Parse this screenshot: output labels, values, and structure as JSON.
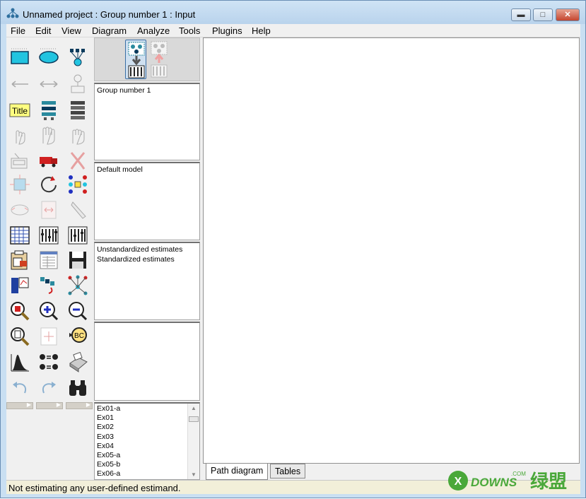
{
  "window": {
    "title": "Unnamed project : Group number 1 : Input",
    "controls": [
      "minimize",
      "maximize",
      "close"
    ]
  },
  "menu": {
    "items": [
      "File",
      "Edit",
      "View",
      "Diagram",
      "Analyze",
      "Tools",
      "Plugins",
      "Help"
    ]
  },
  "toolbox": {
    "icons": [
      "draw-observed-variable-icon",
      "draw-unobserved-variable-icon",
      "draw-indicator-icon",
      "draw-path-icon",
      "draw-covariance-icon",
      "draw-unique-variable-icon",
      "title-icon",
      "list-variables-in-model-icon",
      "list-variables-in-dataset-icon",
      "select-one-object-icon",
      "select-all-objects-icon",
      "deselect-all-objects-icon",
      "duplicate-icon",
      "move-icon",
      "erase-icon",
      "change-shape-icon",
      "rotate-indicators-icon",
      "reflect-indicators-icon",
      "move-parameter-icon",
      "scroll-icon",
      "touch-up-icon",
      "data-files-icon",
      "analysis-properties-icon",
      "calculate-estimates-icon",
      "copy-to-clipboard-icon",
      "view-text-icon",
      "save-diagram-icon",
      "object-properties-icon",
      "drag-properties-icon",
      "preserve-symmetries-icon",
      "zoom-selected-icon",
      "zoom-in-icon",
      "zoom-out-icon",
      "view-page-icon",
      "fit-to-page-icon",
      "loupe-icon",
      "bayesian-estimation-icon",
      "multiple-group-analysis-icon",
      "print-icon",
      "undo-icon",
      "redo-icon",
      "specification-search-icon"
    ],
    "title_label": "Title"
  },
  "io_toolbar": {
    "icons": [
      "view-input-path-diagram-icon",
      "view-output-path-diagram-icon"
    ]
  },
  "panels": {
    "groups": [
      "Group number 1"
    ],
    "models": [
      "Default model"
    ],
    "parameter_formats": [
      "Unstandardized estimates",
      "Standardized estimates"
    ],
    "computation_summary": []
  },
  "files": {
    "items": [
      "Ex01-a",
      "Ex01",
      "Ex02",
      "Ex03",
      "Ex04",
      "Ex05-a",
      "Ex05-b",
      "Ex06-a"
    ]
  },
  "tabs": {
    "path": "Path diagram",
    "tables": "Tables"
  },
  "status": {
    "text": "Not estimating any user-defined estimand."
  },
  "watermark": {
    "text1": "DOWNS",
    "text2": ".COM",
    "text3": "绿盟"
  }
}
